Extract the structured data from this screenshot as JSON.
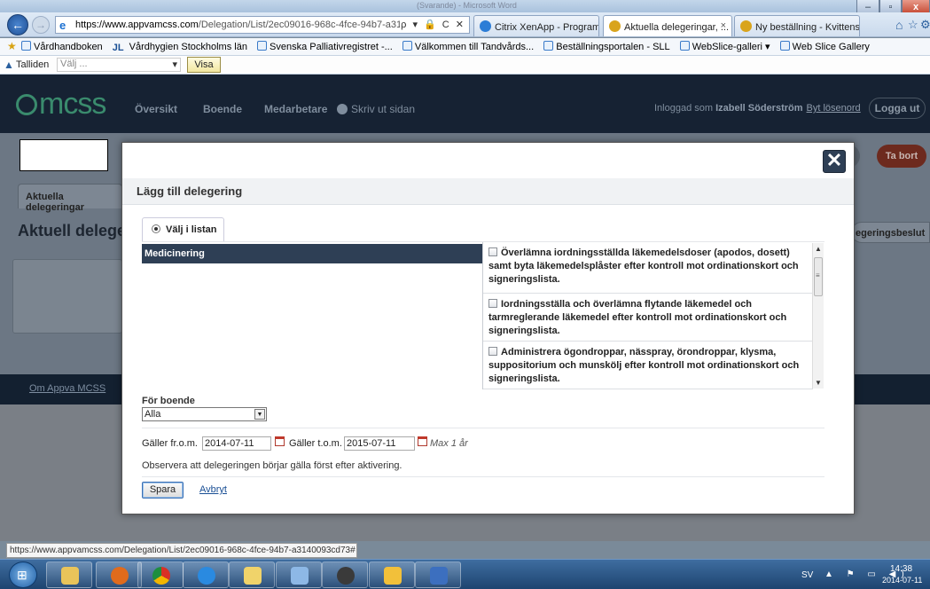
{
  "browser": {
    "window_title": "(Svarande) - Microsoft Word",
    "window_buttons": {
      "minimize": "–",
      "maximize": "▫",
      "close": "x"
    },
    "address": {
      "host": "https://www.appvamcss.com",
      "path": "/Delegation/List/2ec09016-968c-4fce-94b7-a3140093cd7",
      "tools": "ρ ▾ 🔒 C ✕"
    },
    "tabs": [
      {
        "label": "Citrix XenApp - Program"
      },
      {
        "label": "Aktuella delegeringar, ...",
        "close": "×"
      },
      {
        "label": "Ny beställning - Kvittens"
      }
    ],
    "favorites": [
      "Vårdhandboken",
      "Vårdhygien Stockholms län",
      "Svenska Palliativregistret -...",
      "Välkommen till Tandvårds...",
      "Beställningsportalen - SLL",
      "WebSlice-galleri ▾",
      "Web Slice Gallery"
    ],
    "favorites_jl": "JL",
    "command": {
      "home_label": "Talliden",
      "select_placeholder": "Välj ...",
      "select_arrow": "▾",
      "visa_button": "Visa"
    },
    "status_url": "https://www.appvamcss.com/Delegation/List/2ec09016-968c-4fce-94b7-a3140093cd73#"
  },
  "site": {
    "logo": "mcss",
    "nav": [
      "Översikt",
      "Boende",
      "Medarbetare"
    ],
    "print_label": "Skriv ut sidan",
    "logged_in_prefix": "Inloggad som",
    "user_name": "Izabell Söderström",
    "change_password": "Byt lösenord",
    "logout": "Logga ut",
    "tab_aktuella": "Aktuella delegeringar",
    "page_heading": "Aktuell delege",
    "btn_partial": "a",
    "btn_tabort": "Ta bort",
    "btn_beslut": "egeringsbeslut",
    "footer_link": "Om Appva MCSS"
  },
  "modal": {
    "close": "✕",
    "title": "Lägg till delegering",
    "radio_tab_label": "Välj i listan",
    "categories": [
      "Medicinering"
    ],
    "tasks": [
      {
        "label": "Överlämna iordningsställda läkemedelsdoser (apodos, dosett) samt byta läkemedelsplåster efter kontroll mot ordinationskort och signeringslista."
      },
      {
        "label": "Iordningsställa och överlämna flytande läkemedel och tarmreglerande läkemedel efter kontroll mot ordinationskort och signeringslista."
      },
      {
        "label": "Administrera ögondroppar, nässpray, örondroppar, klysma, suppositorium och munskölj efter kontroll mot ordinationskort och signeringslista."
      }
    ],
    "scroll_up": "▲",
    "scroll_down": "▼",
    "scroll_grip": "≡",
    "boende_label": "För boende",
    "boende_value": "Alla",
    "boende_arrow": "▼",
    "from_label": "Gäller fr.o.m.",
    "from_value": "2014-07-11",
    "to_label": "Gäller t.o.m.",
    "to_value": "2015-07-11",
    "max_note": "Max 1 år",
    "notice": "Observera att delegeringen börjar gälla först efter aktivering.",
    "save": "Spara",
    "cancel": "Avbryt"
  },
  "taskbar": {
    "language": "SV",
    "tray_icons": "▲ ⚑ ▭ ◀)",
    "time": "14:38",
    "date": "2014-07-11"
  }
}
